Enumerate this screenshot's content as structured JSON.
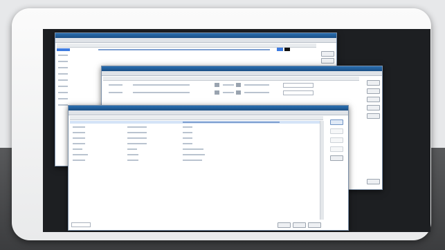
{
  "scene": {
    "frame_color": "#f4f4f5",
    "screen_color": "#1d1f22",
    "titlebar_color": "#1f5a95",
    "selection_color": "#3d7be0"
  },
  "windows": [
    {
      "name": "back-window",
      "title": ""
    },
    {
      "name": "middle-window",
      "title": ""
    },
    {
      "name": "front-window",
      "title": ""
    }
  ]
}
